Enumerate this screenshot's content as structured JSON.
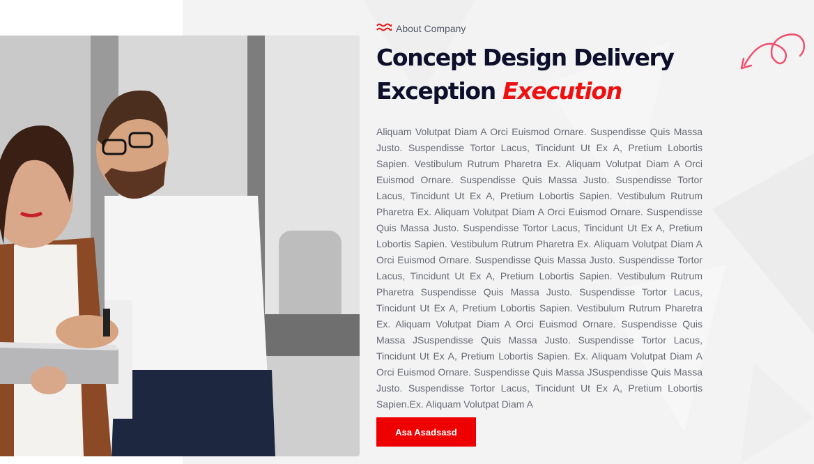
{
  "about": {
    "eyebrow": "About Company",
    "title_line1": "Concept Design Delivery",
    "title_line2": "Exception",
    "title_accent": "Execution",
    "body": "Aliquam Volutpat Diam A Orci Euismod Ornare. Suspendisse Quis Massa Justo. Suspendisse Tortor Lacus, Tincidunt Ut Ex A, Pretium Lobortis Sapien. Vestibulum Rutrum Pharetra Ex. Aliquam Volutpat Diam A Orci Euismod Ornare. Suspendisse Quis Massa Justo. Suspendisse Tortor Lacus, Tincidunt Ut Ex A, Pretium Lobortis Sapien. Vestibulum Rutrum Pharetra Ex. Aliquam Volutpat Diam A Orci Euismod Ornare. Suspendisse Quis Massa Justo. Suspendisse Tortor Lacus, Tincidunt Ut Ex A, Pretium Lobortis Sapien. Vestibulum Rutrum Pharetra Ex. Aliquam Volutpat Diam A Orci Euismod Ornare. Suspendisse Quis Massa Justo. Suspendisse Tortor Lacus, Tincidunt Ut Ex A, Pretium Lobortis Sapien. Vestibulum Rutrum Pharetra Suspendisse Quis Massa Justo. Suspendisse Tortor Lacus, Tincidunt Ut Ex A, Pretium Lobortis Sapien. Vestibulum Rutrum Pharetra Ex. Aliquam Volutpat Diam A Orci Euismod Ornare. Suspendisse Quis Massa JSuspendisse Quis Massa Justo. Suspendisse Tortor Lacus, Tincidunt Ut Ex A, Pretium Lobortis Sapien. Ex. Aliquam Volutpat Diam A Orci Euismod Ornare. Suspendisse Quis Massa JSuspendisse Quis Massa Justo. Suspendisse Tortor Lacus, Tincidunt Ut Ex A, Pretium Lobortis Sapien.Ex. Aliquam Volutpat Diam A",
    "cta_label": "Asa Asadsasd"
  },
  "icons": {
    "eyebrow": "wave-icon",
    "decoration": "curly-arrow-icon",
    "photo": "team-photo"
  },
  "colors": {
    "accent": "#ee1111",
    "heading": "#0d0f2b",
    "body": "#666a72",
    "panel_bg": "#f3f3f4",
    "decoration": "#f0506e"
  }
}
